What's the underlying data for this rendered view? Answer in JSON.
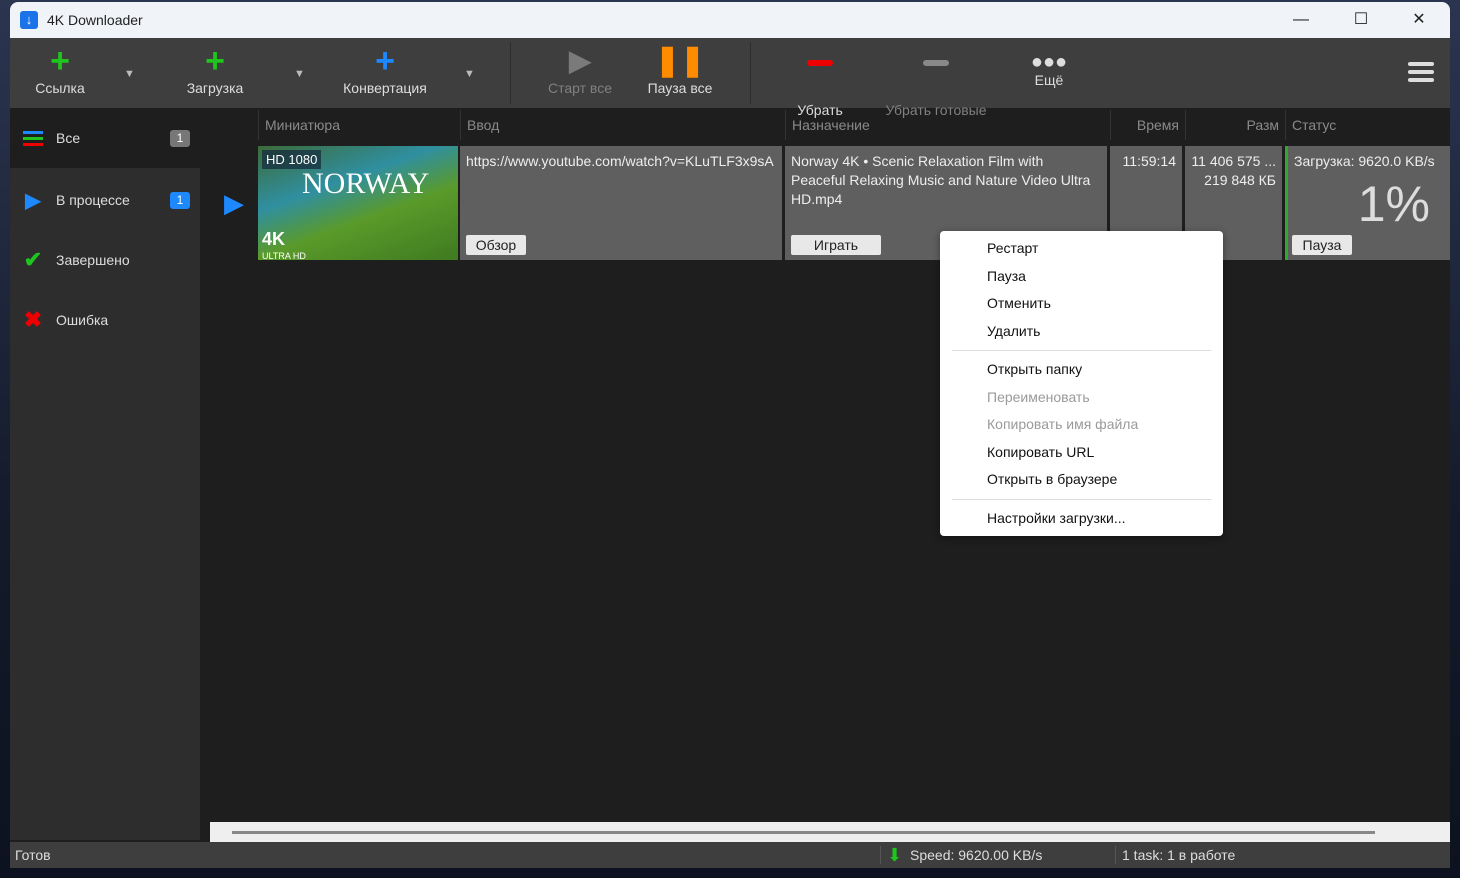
{
  "window": {
    "title": "4K Downloader",
    "minimize": "—",
    "maximize": "☐",
    "close": "✕"
  },
  "toolbar": {
    "link": "Ссылка",
    "download": "Загрузка",
    "convert": "Конвертация",
    "start_all": "Старт все",
    "pause_all": "Пауза все",
    "remove": "Убрать",
    "remove_done": "Убрать готовые",
    "more": "Ещё"
  },
  "sidebar": {
    "items": [
      {
        "label": "Все",
        "count": "1"
      },
      {
        "label": "В процессе",
        "count": "1"
      },
      {
        "label": "Завершено"
      },
      {
        "label": "Ошибка"
      }
    ]
  },
  "columns": [
    "Миниатюра",
    "Ввод",
    "Назначение",
    "Время",
    "Разм",
    "Статус"
  ],
  "row": {
    "thumb_badge": "HD 1080",
    "thumb_title": "NORWAY",
    "thumb_4k": "4K",
    "thumb_uhd": "ULTRA HD",
    "input": "https://www.youtube.com/watch?v=KLuTLF3x9sA",
    "browse": "Обзор",
    "dest": "Norway 4K • Scenic Relaxation Film with Peaceful Relaxing Music and Nature Video Ultra HD.mp4",
    "play": "Играть",
    "time": "11:59:14",
    "size1": "11 406 575 ...",
    "size2": "219 848 КБ",
    "status": "Загрузка: 9620.0 KB/s",
    "percent": "1%",
    "pause": "Пауза"
  },
  "context_menu": {
    "groups": [
      [
        "Рестарт",
        "Пауза",
        "Отменить",
        "Удалить"
      ],
      [
        "Открыть папку",
        "Переименовать",
        "Копировать имя файла",
        "Копировать URL",
        "Открыть в браузере"
      ],
      [
        "Настройки загрузки..."
      ]
    ]
  },
  "statusbar": {
    "left": "Готов",
    "speed": "Speed: 9620.00 KB/s",
    "tasks": "1 task: 1 в работе"
  }
}
